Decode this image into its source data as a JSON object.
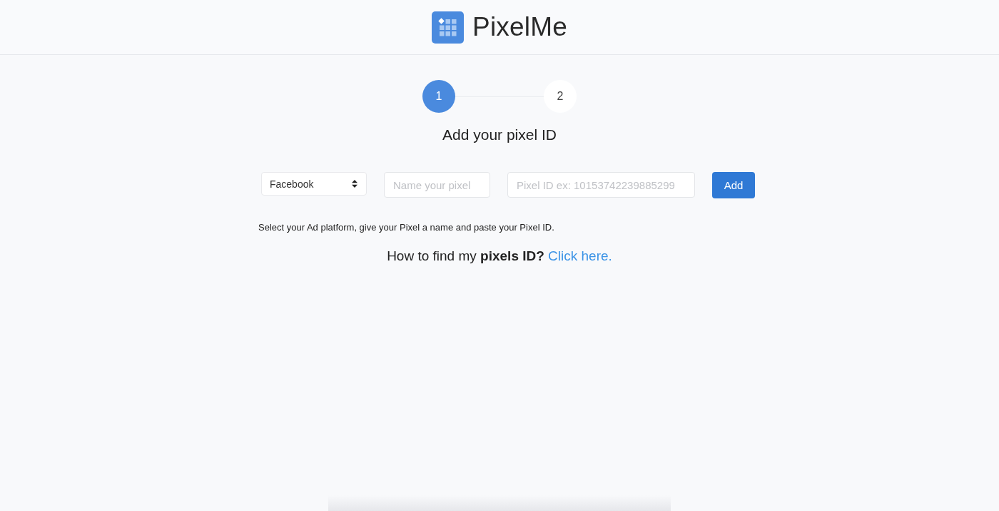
{
  "header": {
    "logo_text": "PixelMe"
  },
  "stepper": {
    "steps": [
      {
        "label": "1",
        "selected": true
      },
      {
        "label": "2",
        "selected": false
      }
    ]
  },
  "title": "Add your pixel ID",
  "form": {
    "platform": {
      "value": "Facebook"
    },
    "name_field": {
      "placeholder": "Name your pixel"
    },
    "id_field": {
      "placeholder": "Pixel ID ex: 10153742239885299"
    },
    "add_button": "Add"
  },
  "instructions": "Select your Ad platform, give your Pixel a name and paste your Pixel ID.",
  "help": {
    "text": "How to find my **pixels ID?**",
    "link": "Click here."
  }
}
